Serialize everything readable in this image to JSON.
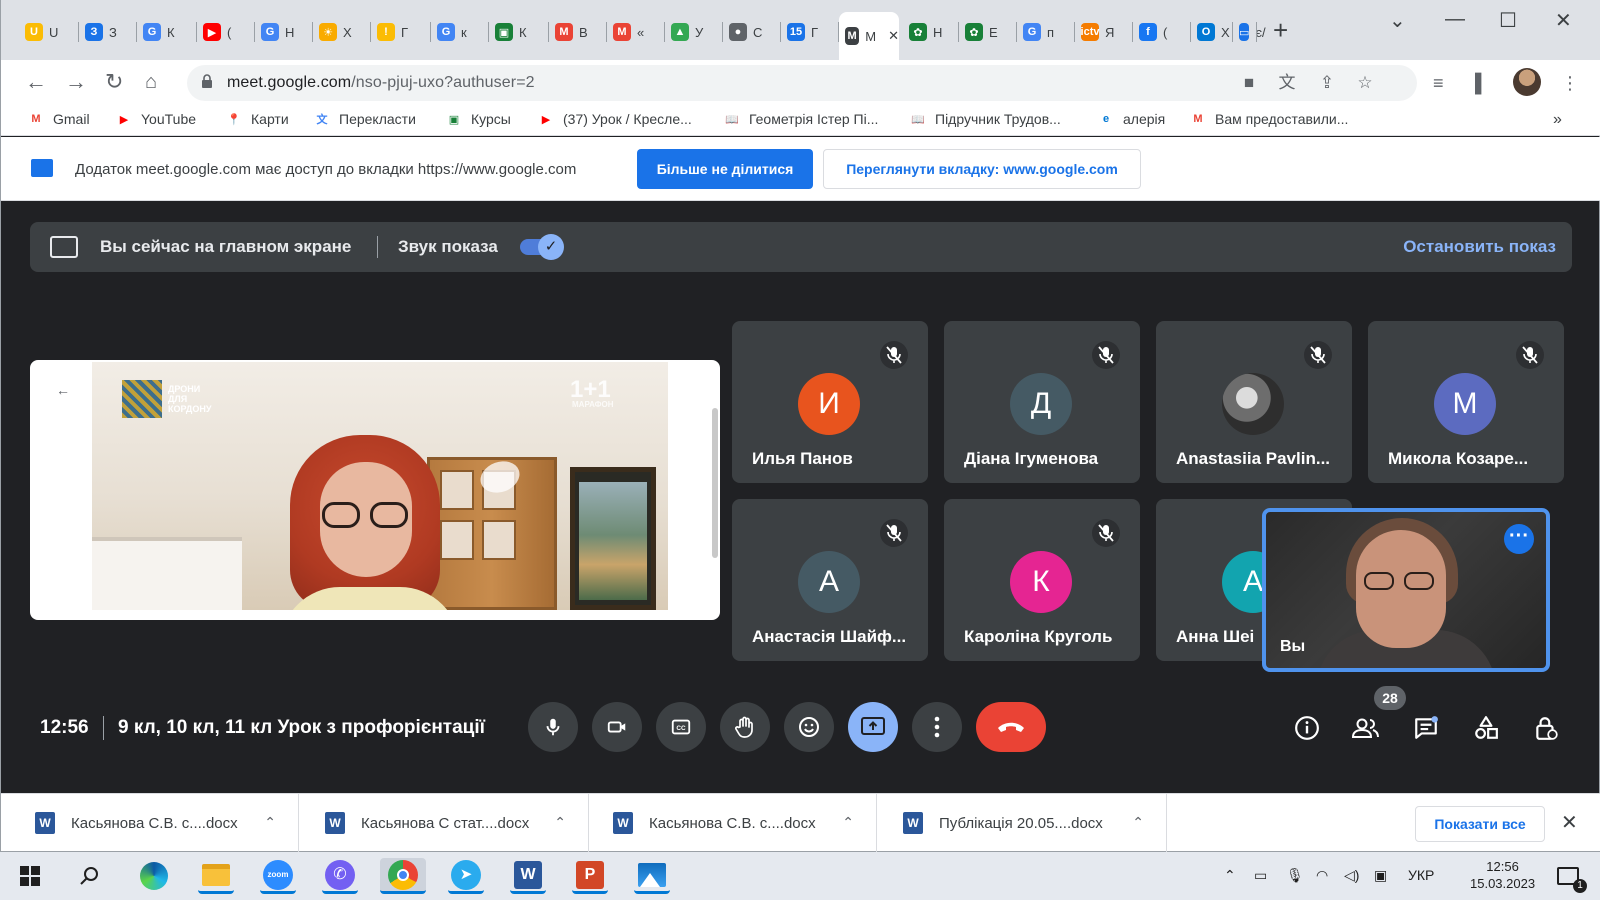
{
  "browser": {
    "tabs": [
      {
        "icon": "word-icon",
        "letter": "U",
        "color": "#fbbc04",
        "label": "U"
      },
      {
        "icon": "contacts-icon",
        "letter": "З",
        "color": "#1a73e8",
        "label": "З"
      },
      {
        "icon": "google-icon",
        "letter": "G",
        "color": "#4285f4",
        "label": "К"
      },
      {
        "icon": "youtube-icon",
        "letter": "▶",
        "color": "#ff0000",
        "label": "("
      },
      {
        "icon": "google-icon",
        "letter": "G",
        "color": "#4285f4",
        "label": "Н"
      },
      {
        "icon": "sun-icon",
        "letter": "☀",
        "color": "#f9ab00",
        "label": "Х"
      },
      {
        "icon": "warning-icon",
        "letter": "!",
        "color": "#fbbc04",
        "label": "Г"
      },
      {
        "icon": "google-icon",
        "letter": "G",
        "color": "#4285f4",
        "label": "к"
      },
      {
        "icon": "classroom-icon",
        "letter": "▣",
        "color": "#188038",
        "label": "К"
      },
      {
        "icon": "gmail-icon",
        "letter": "M",
        "color": "#ea4335",
        "label": "В"
      },
      {
        "icon": "gmail-icon",
        "letter": "M",
        "color": "#ea4335",
        "label": "«"
      },
      {
        "icon": "drive-icon",
        "letter": "▲",
        "color": "#34a853",
        "label": "У"
      },
      {
        "icon": "globe-icon",
        "letter": "●",
        "color": "#5f6368",
        "label": "С"
      },
      {
        "icon": "calendar-icon",
        "letter": "15",
        "color": "#1a73e8",
        "label": "Г"
      },
      {
        "icon": "meet-icon",
        "letter": "M",
        "color": "#3c4043",
        "label": "M"
      },
      {
        "icon": "extension-icon",
        "letter": "✿",
        "color": "#188038",
        "label": "Н"
      },
      {
        "icon": "extension-icon",
        "letter": "✿",
        "color": "#188038",
        "label": "Е"
      },
      {
        "icon": "google-icon",
        "letter": "G",
        "color": "#4285f4",
        "label": "п"
      },
      {
        "icon": "ictv-icon",
        "letter": "ictv",
        "color": "#f57c00",
        "label": "Я"
      },
      {
        "icon": "facebook-icon",
        "letter": "f",
        "color": "#1877f2",
        "label": "("
      },
      {
        "icon": "outlook-icon",
        "letter": "O",
        "color": "#0078d4",
        "label": "Х"
      },
      {
        "icon": "screen-icon",
        "letter": "▭",
        "color": "#1a73e8",
        "label": "є/"
      }
    ],
    "url_host": "meet.google.com",
    "url_path": "/nso-pjuj-uxo?authuser=2",
    "bookmarks": [
      {
        "icon": "gmail-icon",
        "glyph": "M",
        "color": "#ea4335",
        "label": "Gmail"
      },
      {
        "icon": "youtube-icon",
        "glyph": "▶",
        "color": "#ff0000",
        "label": "YouTube"
      },
      {
        "icon": "maps-icon",
        "glyph": "📍",
        "color": "#34a853",
        "label": "Карти"
      },
      {
        "icon": "translate-icon",
        "glyph": "文",
        "color": "#4285f4",
        "label": "Перекласти"
      },
      {
        "icon": "classroom-icon",
        "glyph": "▣",
        "color": "#188038",
        "label": "Курсы"
      },
      {
        "icon": "youtube-icon",
        "glyph": "▶",
        "color": "#ff0000",
        "label": "(37) Урок / Кресле..."
      },
      {
        "icon": "book-icon",
        "glyph": "📖",
        "color": "#8d6e63",
        "label": "Геометрія Істер Пі..."
      },
      {
        "icon": "book-icon",
        "glyph": "📖",
        "color": "#8d6e63",
        "label": "Підручник Трудов..."
      },
      {
        "icon": "edge-icon",
        "glyph": "e",
        "color": "#0078d4",
        "label": "алерія"
      },
      {
        "icon": "gmail-icon",
        "glyph": "M",
        "color": "#ea4335",
        "label": "Вам предоставили..."
      }
    ]
  },
  "infobar": {
    "message": "Додаток meet.google.com має доступ до вкладки https://www.google.com",
    "stop_sharing": "Більше не ділитися",
    "view_tab": "Переглянути вкладку: www.google.com"
  },
  "meet": {
    "present_bar": {
      "text": "Вы сейчас на главном экране",
      "sound_label": "Звук показа",
      "sound_on": true,
      "stop": "Остановить показ"
    },
    "presentation": {
      "logo_text": "ДРОНИ\nДЛЯ\nКОРДОНУ",
      "channel": "1+1",
      "channel_sub": "МАРАФОН"
    },
    "participants": [
      {
        "initial": "И",
        "color": "#e8541e",
        "name": "Илья Панов",
        "muted": true
      },
      {
        "initial": "Д",
        "color": "#455a64",
        "name": "Діана Ігуменова",
        "muted": true
      },
      {
        "initial": "",
        "color": "#777",
        "name": "Anastasiia Pavlin...",
        "muted": true,
        "photo": true
      },
      {
        "initial": "М",
        "color": "#5c6bc0",
        "name": "Микола Козаре...",
        "muted": true
      },
      {
        "initial": "А",
        "color": "#455a64",
        "name": "Анастасія Шайф...",
        "muted": true
      },
      {
        "initial": "К",
        "color": "#e52592",
        "name": "Кароліна Круголь",
        "muted": true
      },
      {
        "initial": "А",
        "color": "#12a4af",
        "name": "Анна Шеі",
        "muted": false
      }
    ],
    "self_label": "Вы",
    "time": "12:56",
    "meeting_title": "9 кл, 10 кл, 11 кл Урок з профорієнтації",
    "participant_count": "28"
  },
  "downloads": {
    "items": [
      "Касьянова С.В. с....docx",
      "Касьянова С стат....docx",
      "Касьянова С.В. с....docx",
      "Публікація 20.05....docx"
    ],
    "show_all": "Показати все"
  },
  "taskbar": {
    "lang": "УКР",
    "time": "12:56",
    "date": "15.03.2023",
    "notifications": "1"
  }
}
